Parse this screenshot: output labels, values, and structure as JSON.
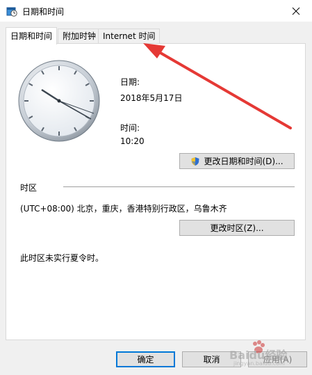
{
  "window": {
    "title": "日期和时间",
    "close_icon": "close-icon",
    "app_icon": "datetime-app-icon"
  },
  "tabs": [
    {
      "label": "日期和时间",
      "active": true
    },
    {
      "label": "附加时钟",
      "active": false
    },
    {
      "label": "Internet 时间",
      "active": false
    }
  ],
  "datetime": {
    "date_label": "日期:",
    "date_value": "2018年5月17日",
    "time_label": "时间:",
    "time_value": "10:20",
    "change_button": "更改日期和时间(D)...",
    "shield_icon": "uac-shield-icon"
  },
  "timezone": {
    "section_label": "时区",
    "value": "(UTC+08:00) 北京，重庆，香港特别行政区，乌鲁木齐",
    "change_button": "更改时区(Z)...",
    "dst_note": "此时区未实行夏令时。"
  },
  "footer": {
    "ok": "确定",
    "cancel": "取消",
    "apply": "应用(A)"
  },
  "watermark": {
    "text": "Baidu经验",
    "sub": "jingyan.baidu.com"
  },
  "colors": {
    "accent": "#0078d7",
    "annotation_arrow": "#e53935"
  }
}
